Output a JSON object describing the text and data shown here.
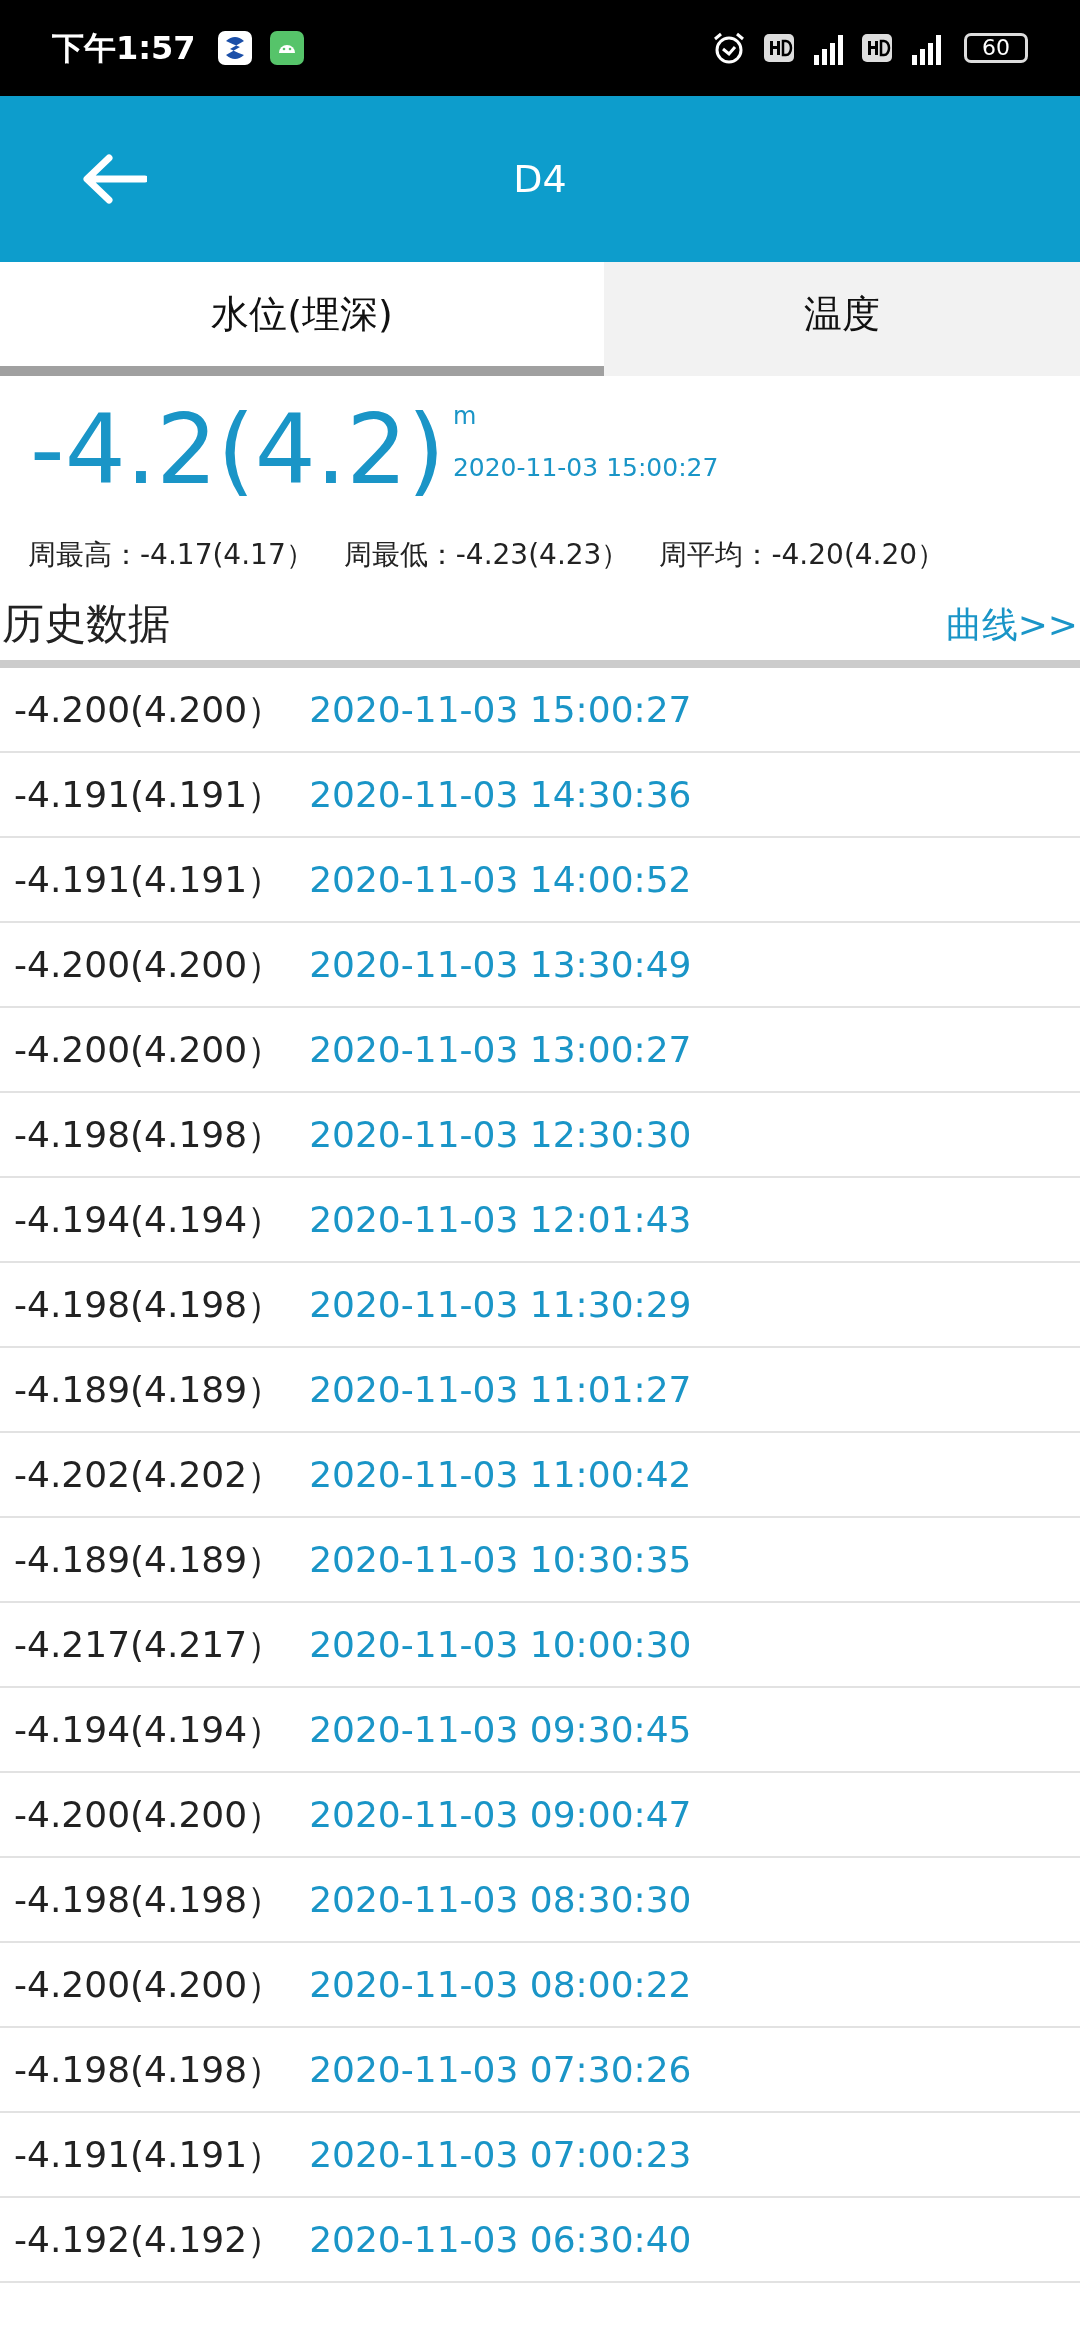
{
  "status_bar": {
    "time": "下午1:57",
    "battery": "60"
  },
  "header": {
    "title": "D4"
  },
  "tabs": [
    {
      "label": "水位(埋深)",
      "selected": true
    },
    {
      "label": "温度",
      "selected": false
    }
  ],
  "current": {
    "value": "-4.2(4.2)",
    "unit": "m",
    "time": "2020-11-03 15:00:27"
  },
  "week_stats": [
    {
      "label": "周最高：",
      "value": "-4.17(4.17）"
    },
    {
      "label": "周最低：",
      "value": "-4.23(4.23）"
    },
    {
      "label": "周平均：",
      "value": "-4.20(4.20）"
    }
  ],
  "history": {
    "title": "历史数据",
    "chart_link": "曲线>>",
    "rows": [
      {
        "value": "-4.200(4.200）",
        "time": "2020-11-03 15:00:27"
      },
      {
        "value": "-4.191(4.191）",
        "time": "2020-11-03 14:30:36"
      },
      {
        "value": "-4.191(4.191）",
        "time": "2020-11-03 14:00:52"
      },
      {
        "value": "-4.200(4.200）",
        "time": "2020-11-03 13:30:49"
      },
      {
        "value": "-4.200(4.200）",
        "time": "2020-11-03 13:00:27"
      },
      {
        "value": "-4.198(4.198）",
        "time": "2020-11-03 12:30:30"
      },
      {
        "value": "-4.194(4.194）",
        "time": "2020-11-03 12:01:43"
      },
      {
        "value": "-4.198(4.198）",
        "time": "2020-11-03 11:30:29"
      },
      {
        "value": "-4.189(4.189）",
        "time": "2020-11-03 11:01:27"
      },
      {
        "value": "-4.202(4.202）",
        "time": "2020-11-03 11:00:42"
      },
      {
        "value": "-4.189(4.189）",
        "time": "2020-11-03 10:30:35"
      },
      {
        "value": "-4.217(4.217）",
        "time": "2020-11-03 10:00:30"
      },
      {
        "value": "-4.194(4.194）",
        "time": "2020-11-03 09:30:45"
      },
      {
        "value": "-4.200(4.200）",
        "time": "2020-11-03 09:00:47"
      },
      {
        "value": "-4.198(4.198）",
        "time": "2020-11-03 08:30:30"
      },
      {
        "value": "-4.200(4.200）",
        "time": "2020-11-03 08:00:22"
      },
      {
        "value": "-4.198(4.198）",
        "time": "2020-11-03 07:30:26"
      },
      {
        "value": "-4.191(4.191）",
        "time": "2020-11-03 07:00:23"
      },
      {
        "value": "-4.192(4.192）",
        "time": "2020-11-03 06:30:40"
      }
    ]
  }
}
